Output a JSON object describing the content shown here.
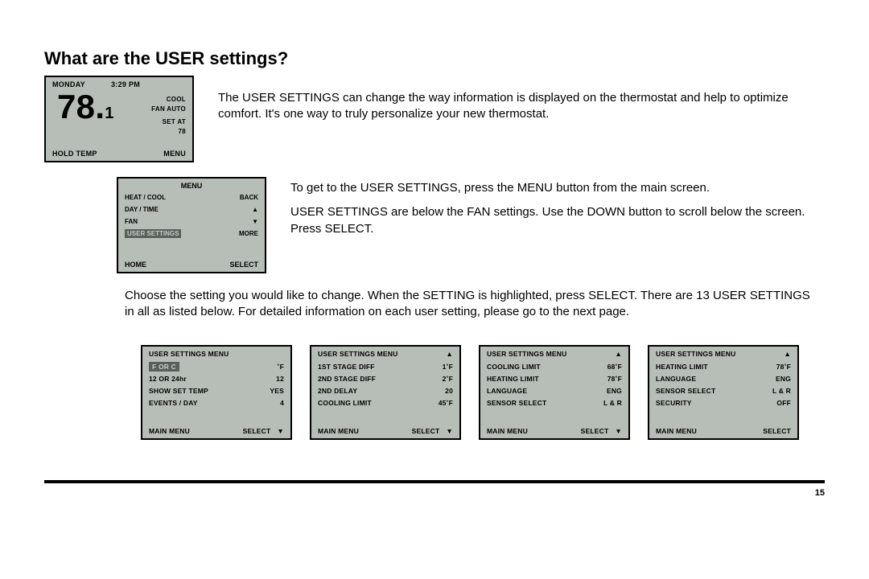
{
  "heading": "What are the USER settings?",
  "intro": "The USER SETTINGS can change the way information is displayed on the thermostat and help to optimize comfort. It's one way to truly personalize your new thermostat.",
  "nav_para_1": "To get to the USER SETTINGS, press the MENU button from the main screen.",
  "nav_para_2": "USER SETTINGS are below the FAN settings. Use the DOWN button to scroll below the screen. Press SELECT.",
  "body2": "Choose the setting you would like to change. When the SETTING is highlighted, press SELECT. There are 13 USER SETTINGS in all as listed below. For detailed information on each user setting, please go to the next page.",
  "page_number": "15",
  "main_lcd": {
    "day": "MONDAY",
    "time": "3:29 PM",
    "temp_whole": "78.",
    "temp_frac": "1",
    "mode": "COOL",
    "fan": "FAN AUTO",
    "setat_label": "SET AT",
    "setat_value": "78",
    "bottom_left": "HOLD TEMP",
    "bottom_right": "MENU"
  },
  "menu_lcd": {
    "title": "MENU",
    "items": [
      {
        "label": "HEAT / COOL",
        "right": "BACK"
      },
      {
        "label": "DAY / TIME",
        "right": "▲"
      },
      {
        "label": "FAN",
        "right": "▼"
      },
      {
        "label": "USER SETTINGS",
        "right": "MORE",
        "selected": true
      }
    ],
    "bottom_left": "HOME",
    "bottom_right": "SELECT"
  },
  "panels": [
    {
      "title": "USER SETTINGS MENU",
      "show_up": false,
      "rows": [
        {
          "label": "F  OR  C",
          "value": "˚F",
          "selected": true
        },
        {
          "label": "12 OR 24hr",
          "value": "12"
        },
        {
          "label": "SHOW SET TEMP",
          "value": "YES"
        },
        {
          "label": "EVENTS / DAY",
          "value": "4"
        }
      ],
      "bottom_left": "MAIN MENU",
      "bottom_right": "SELECT",
      "show_down": true
    },
    {
      "title": "USER SETTINGS MENU",
      "show_up": true,
      "rows": [
        {
          "label": "1ST STAGE DIFF",
          "value": "1˚F"
        },
        {
          "label": "2ND STAGE DIFF",
          "value": "2˚F"
        },
        {
          "label": "2ND DELAY",
          "value": "20"
        },
        {
          "label": "COOLING LIMIT",
          "value": "45˚F"
        }
      ],
      "bottom_left": "MAIN MENU",
      "bottom_right": "SELECT",
      "show_down": true
    },
    {
      "title": "USER SETTINGS MENU",
      "show_up": true,
      "rows": [
        {
          "label": "COOLING LIMIT",
          "value": "68˚F"
        },
        {
          "label": "HEATING LIMIT",
          "value": "78˚F"
        },
        {
          "label": "LANGUAGE",
          "value": "ENG"
        },
        {
          "label": "SENSOR SELECT",
          "value": "L & R"
        }
      ],
      "bottom_left": "MAIN MENU",
      "bottom_right": "SELECT",
      "show_down": true
    },
    {
      "title": "USER SETTINGS MENU",
      "show_up": true,
      "rows": [
        {
          "label": "HEATING LIMIT",
          "value": "78˚F"
        },
        {
          "label": "LANGUAGE",
          "value": "ENG"
        },
        {
          "label": "SENSOR SELECT",
          "value": "L & R"
        },
        {
          "label": "SECURITY",
          "value": "OFF"
        }
      ],
      "bottom_left": "MAIN MENU",
      "bottom_right": "SELECT",
      "show_down": false
    }
  ]
}
